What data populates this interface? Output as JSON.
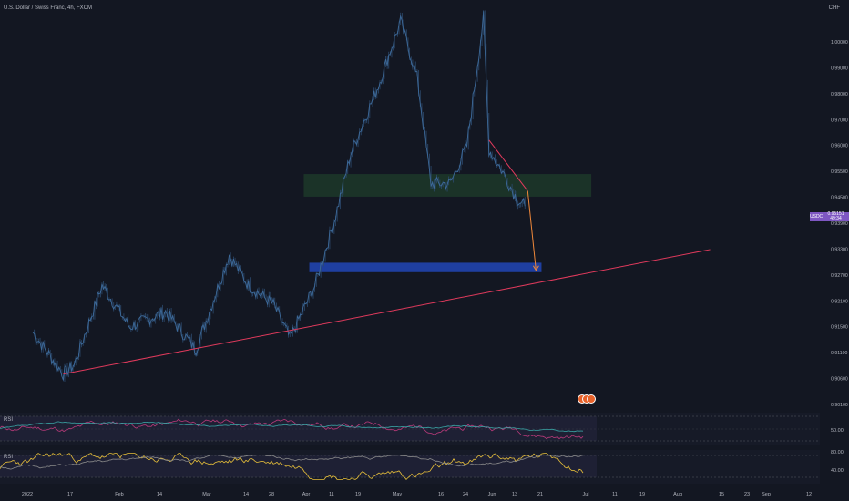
{
  "header": {
    "title": "U.S. Dollar / Swiss Franc, 4h, FXCM",
    "currency": "CHF"
  },
  "price_tag": {
    "symbol": "USDCHF",
    "price": "0.95151",
    "countdown": "49:34"
  },
  "colors": {
    "background": "#131722",
    "candle": "#2c4a6e",
    "trendline": "#e03a5c",
    "green_zone": "#1e3b2a",
    "blue_zone": "#1f3fa0",
    "arrow": "#f0883a",
    "rsi_line": "#b93a7a",
    "rsi_ma": "#3aa5a5",
    "osc_line": "#e8c03a",
    "osc_ma": "#8a8a8a"
  },
  "price_axis_labels": [
    "1.00000",
    "0.99000",
    "0.98000",
    "0.97000",
    "0.96000",
    "0.95500",
    "0.94500",
    "0.93900",
    "0.93300",
    "0.92700",
    "0.92100",
    "0.91500",
    "0.91100",
    "0.90600",
    "0.90100"
  ],
  "time_axis_labels": [
    "2022",
    "17",
    "Feb",
    "14",
    "Mar",
    "14",
    "28",
    "Apr",
    "11",
    "19",
    "May",
    "16",
    "24",
    "Jun",
    "13",
    "21",
    "Jul",
    "11",
    "19",
    "Aug",
    "15",
    "23",
    "Sep",
    "12"
  ],
  "indicators": [
    {
      "label": "RSI",
      "levels": [
        "50.00"
      ]
    },
    {
      "label": "RSI",
      "levels": [
        "80.00",
        "40.00"
      ]
    }
  ],
  "chart_data": {
    "type": "line",
    "title": "U.S. Dollar / Swiss Franc, 4h, FXCM",
    "ylim": [
      0.9,
      1.005
    ],
    "series": [
      {
        "values": [
          {
            "x": "2022-01-03",
            "y": 0.9205
          },
          {
            "x": "2022-01-14",
            "y": 0.9095
          },
          {
            "x": "2022-01-18",
            "y": 0.912
          },
          {
            "x": "2022-01-28",
            "y": 0.933
          },
          {
            "x": "2022-02-07",
            "y": 0.922
          },
          {
            "x": "2022-02-20",
            "y": 0.926
          },
          {
            "x": "2022-03-03",
            "y": 0.916
          },
          {
            "x": "2022-03-15",
            "y": 0.941
          },
          {
            "x": "2022-03-22",
            "y": 0.933
          },
          {
            "x": "2022-03-31",
            "y": 0.928
          },
          {
            "x": "2022-04-06",
            "y": 0.919
          },
          {
            "x": "2022-04-15",
            "y": 0.933
          },
          {
            "x": "2022-04-22",
            "y": 0.95
          },
          {
            "x": "2022-04-28",
            "y": 0.968
          },
          {
            "x": "2022-05-08",
            "y": 0.986
          },
          {
            "x": "2022-05-16",
            "y": 1.003
          },
          {
            "x": "2022-05-22",
            "y": 0.988
          },
          {
            "x": "2022-05-27",
            "y": 0.96
          },
          {
            "x": "2022-06-03",
            "y": 0.96
          },
          {
            "x": "2022-06-09",
            "y": 0.97
          },
          {
            "x": "2022-06-15",
            "y": 1.004
          },
          {
            "x": "2022-06-17",
            "y": 0.969
          },
          {
            "x": "2022-06-22",
            "y": 0.963
          },
          {
            "x": "2022-06-27",
            "y": 0.956
          },
          {
            "x": "2022-06-30",
            "y": 0.954
          }
        ]
      }
    ],
    "trendline": {
      "from": {
        "x": "2022-01-14",
        "y": 0.9095
      },
      "to": {
        "x": "2022-09-05",
        "y": 0.9425
      }
    },
    "zones": [
      {
        "from_x": "2022-04-11",
        "to_x": "2022-07-24",
        "y_low": 0.9565,
        "y_high": 0.9625
      },
      {
        "from_x": "2022-04-13",
        "to_x": "2022-07-06",
        "y_low": 0.9365,
        "y_high": 0.939
      }
    ],
    "projection": [
      {
        "x": "2022-06-17",
        "y": 0.9715
      },
      {
        "x": "2022-07-01",
        "y": 0.958
      },
      {
        "x": "2022-07-04",
        "y": 0.937
      }
    ]
  }
}
